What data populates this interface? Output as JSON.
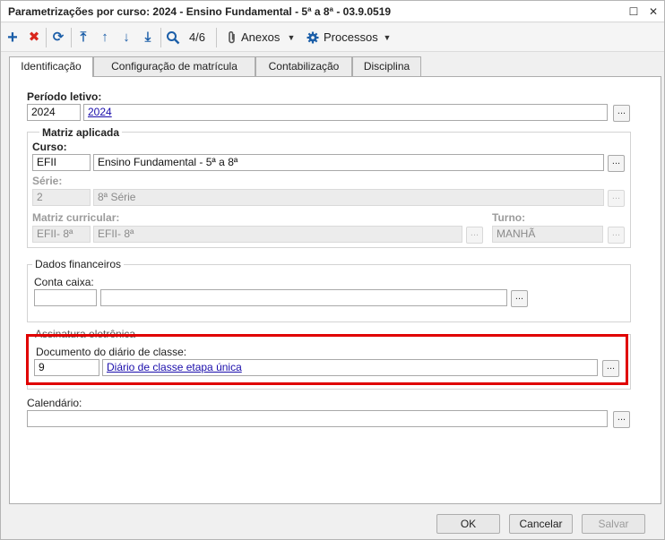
{
  "window": {
    "title": "Parametrizações por curso: 2024 - Ensino Fundamental - 5ª a 8ª - 03.9.0519",
    "restore_glyph": "☐",
    "close_glyph": "✕"
  },
  "toolbar": {
    "add_glyph": "+",
    "delete_glyph": "✖",
    "refresh_glyph": "⟳",
    "first_glyph": "⤒",
    "prev_glyph": "↑",
    "next_glyph": "↓",
    "last_glyph": "⤓",
    "search_glyph": "🔍",
    "record_position": "4/6",
    "attachments_label": "Anexos",
    "processes_label": "Processos",
    "dropdown_glyph": "▼",
    "accent_color": "#1b5ea8",
    "delete_color": "#d9261c"
  },
  "tabs": [
    {
      "label": "Identificação"
    },
    {
      "label": "Configuração de matrícula"
    },
    {
      "label": "Contabilização"
    },
    {
      "label": "Disciplina"
    }
  ],
  "form": {
    "periodo": {
      "label": "Período letivo:",
      "code": "2024",
      "description": "2024"
    },
    "matriz": {
      "title": "Matriz aplicada",
      "curso": {
        "label": "Curso:",
        "code": "EFII",
        "description": "Ensino Fundamental - 5ª a 8ª"
      },
      "serie": {
        "label": "Série:",
        "code": "2",
        "description": "8ª Série"
      },
      "matriz_curricular": {
        "label": "Matriz curricular:",
        "code": "EFII- 8ª",
        "description": "EFII- 8ª"
      },
      "turno": {
        "label": "Turno:",
        "value": "MANHÃ"
      }
    },
    "dados_financeiros": {
      "title": "Dados financeiros",
      "conta_caixa": {
        "label": "Conta caixa:",
        "code": "",
        "description": ""
      }
    },
    "assinatura": {
      "title": "Assinatura eletrônica",
      "documento": {
        "label": "Documento do diário de classe:",
        "code": "9",
        "description": "Diário de classe etapa única"
      },
      "highlight_color": "#e00000"
    },
    "calendario": {
      "label": "Calendário:",
      "code": ""
    },
    "lookup_glyph": "..."
  },
  "footer": {
    "ok_label": "OK",
    "cancel_label": "Cancelar",
    "save_label": "Salvar"
  }
}
